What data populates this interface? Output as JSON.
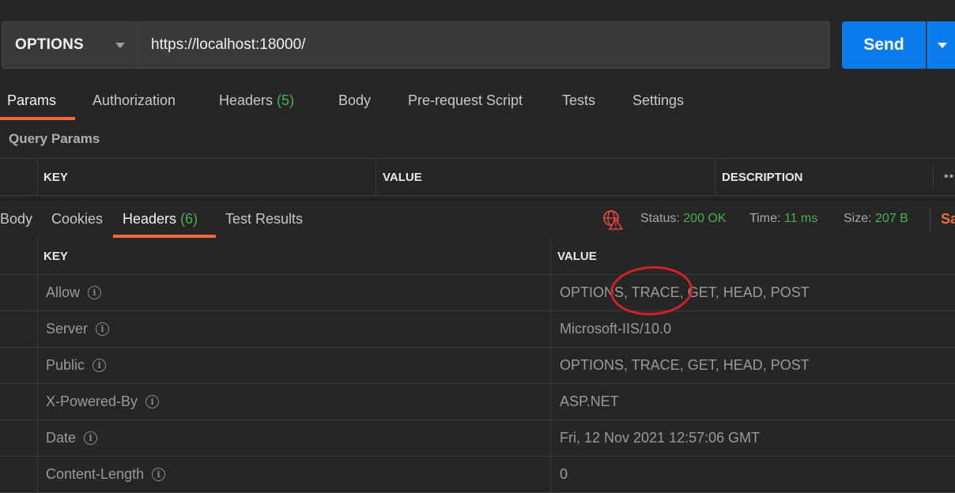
{
  "request": {
    "method": "OPTIONS",
    "url": "https://localhost:18000/",
    "send_label": "Send"
  },
  "request_tabs": [
    {
      "label": "Params",
      "active": true
    },
    {
      "label": "Authorization"
    },
    {
      "label": "Headers",
      "count": "(5)"
    },
    {
      "label": "Body"
    },
    {
      "label": "Pre-request Script"
    },
    {
      "label": "Tests"
    },
    {
      "label": "Settings"
    }
  ],
  "query_params": {
    "title": "Query Params",
    "columns": [
      "KEY",
      "VALUE",
      "DESCRIPTION"
    ],
    "more": "••"
  },
  "response_tabs": [
    {
      "label": "Body"
    },
    {
      "label": "Cookies"
    },
    {
      "label": "Headers",
      "count": "(6)",
      "active": true
    },
    {
      "label": "Test Results"
    }
  ],
  "status": {
    "status_label": "Status:",
    "status_value": "200 OK",
    "time_label": "Time:",
    "time_value": "11 ms",
    "size_label": "Size:",
    "size_value": "207 B",
    "save_partial": "Sa",
    "status_color": "#4caf50"
  },
  "response_headers": {
    "columns": [
      "KEY",
      "VALUE"
    ],
    "rows": [
      {
        "key": "Allow",
        "value": "OPTIONS, TRACE, GET, HEAD, POST"
      },
      {
        "key": "Server",
        "value": "Microsoft-IIS/10.0"
      },
      {
        "key": "Public",
        "value": "OPTIONS, TRACE, GET, HEAD, POST"
      },
      {
        "key": "X-Powered-By",
        "value": "ASP.NET"
      },
      {
        "key": "Date",
        "value": "Fri, 12 Nov 2021 12:57:06 GMT"
      },
      {
        "key": "Content-Length",
        "value": "0"
      }
    ]
  },
  "info_glyph": "i",
  "colors": {
    "accent": "#f26b3a",
    "send": "#097bed",
    "annotation": "#d3202a"
  }
}
